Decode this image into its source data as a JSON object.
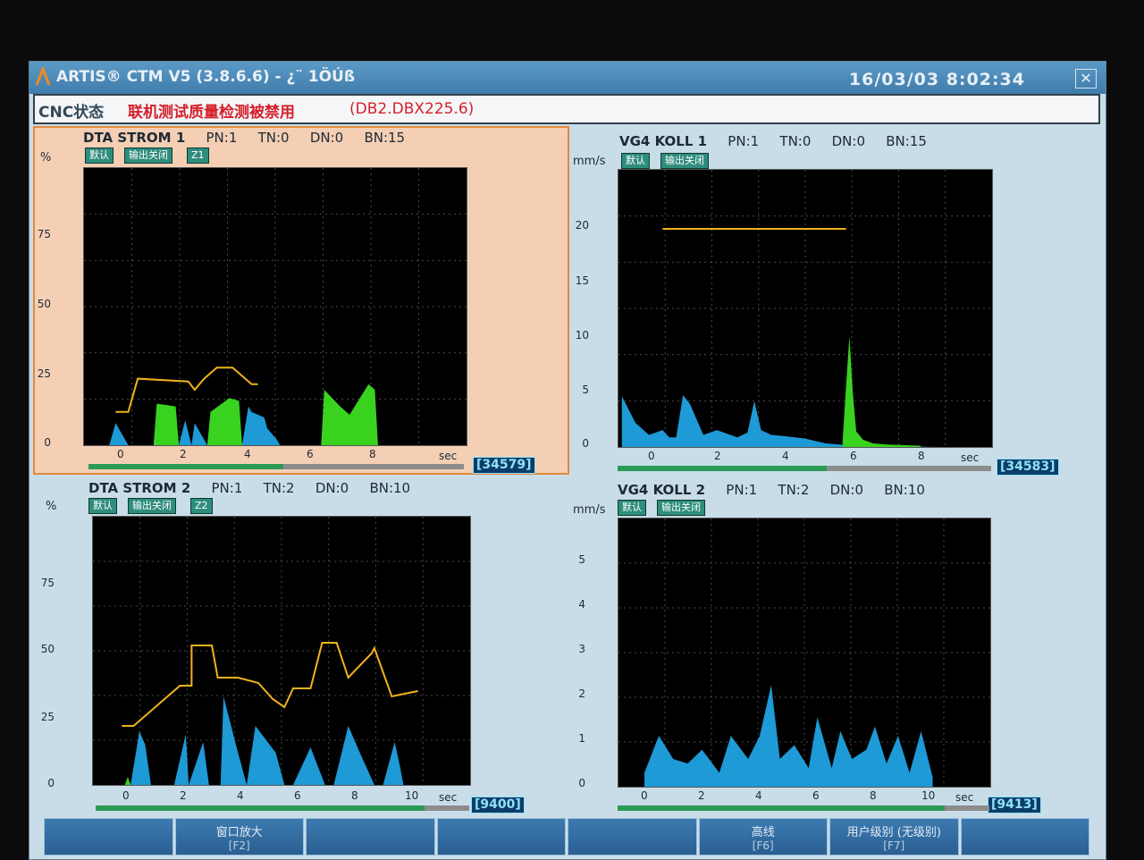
{
  "window": {
    "title": "ARTIS® CTM V5 (3.8.6.6) - ¿¨ 1ÖÚß",
    "clock": "16/03/03 8:02:34",
    "close_icon": "close-icon"
  },
  "status": {
    "label": "CNC状态",
    "message": "联机测试质量检测被禁用",
    "code": "(DB2.DBX225.6)"
  },
  "panels": [
    {
      "name": "DTA STROM 1",
      "pn": "PN:1",
      "tn": "TN:0",
      "dn": "DN:0",
      "bn": "BN:15",
      "tags": [
        "默认",
        "输出关闭",
        "Z1"
      ],
      "unit": "%",
      "yticks": [
        "75",
        "50",
        "25",
        "0"
      ],
      "xticks": [
        "0",
        "2",
        "4",
        "6",
        "8"
      ],
      "xunit": "sec",
      "sample_count": "[34579]",
      "progress": 0.52
    },
    {
      "name": "VG4 KOLL 1",
      "pn": "PN:1",
      "tn": "TN:0",
      "dn": "DN:0",
      "bn": "BN:15",
      "tags": [
        "默认",
        "输出关闭"
      ],
      "unit": "mm/s",
      "yticks": [
        "20",
        "15",
        "10",
        "5",
        "0"
      ],
      "xticks": [
        "0",
        "2",
        "4",
        "6",
        "8"
      ],
      "xunit": "sec",
      "sample_count": "[34583]",
      "progress": 0.56
    },
    {
      "name": "DTA STROM 2",
      "pn": "PN:1",
      "tn": "TN:2",
      "dn": "DN:0",
      "bn": "BN:10",
      "tags": [
        "默认",
        "输出关闭",
        "Z2"
      ],
      "unit": "%",
      "yticks": [
        "75",
        "50",
        "25",
        "0"
      ],
      "xticks": [
        "0",
        "2",
        "4",
        "6",
        "8",
        "10"
      ],
      "xunit": "sec",
      "sample_count": "[9400]",
      "progress": 0.88
    },
    {
      "name": "VG4 KOLL 2",
      "pn": "PN:1",
      "tn": "TN:2",
      "dn": "DN:0",
      "bn": "BN:10",
      "tags": [
        "默认",
        "输出关闭"
      ],
      "unit": "mm/s",
      "yticks": [
        "5",
        "4",
        "3",
        "2",
        "1",
        "0"
      ],
      "xticks": [
        "0",
        "2",
        "4",
        "6",
        "8",
        "10"
      ],
      "xunit": "sec",
      "sample_count": "[9413]",
      "progress": 0.88
    }
  ],
  "fkeys": [
    {
      "label": "",
      "key": ""
    },
    {
      "label": "窗口放大",
      "key": "[F2]"
    },
    {
      "label": "",
      "key": ""
    },
    {
      "label": "",
      "key": ""
    },
    {
      "label": "",
      "key": ""
    },
    {
      "label": "高线",
      "key": "[F6]"
    },
    {
      "label": "用户级别 (无级别)",
      "key": "[F7]"
    },
    {
      "label": "",
      "key": ""
    }
  ],
  "colors": {
    "fill_blue": "#1e9ad6",
    "fill_green": "#39d21f",
    "fill_red": "#e02020",
    "limit_yellow": "#f0b21a",
    "grid": "#4a4a4a"
  },
  "chart_data": [
    {
      "type": "area",
      "ylabel": "%",
      "xlabel": "sec",
      "ylim": [
        0,
        100
      ],
      "xlim": [
        -0.8,
        11.3
      ],
      "series": [
        {
          "color": "blue",
          "x": [
            0.0,
            0.2,
            0.4,
            0.6,
            1.4,
            1.5,
            1.7,
            2.1,
            2.2,
            2.4,
            2.6,
            2.7,
            3.1,
            3.2,
            3.6,
            3.7,
            4.1,
            4.2,
            4.4,
            4.5,
            4.9,
            5.0,
            5.3,
            5.4
          ],
          "y": [
            0,
            8,
            4,
            0,
            0,
            12,
            11,
            13,
            0,
            9,
            0,
            8,
            0,
            9,
            12,
            8,
            16,
            0,
            14,
            12,
            10,
            6,
            2,
            0
          ]
        },
        {
          "color": "green",
          "x": [
            1.4,
            1.5,
            2.1,
            2.2,
            3.1,
            3.2,
            3.8,
            4.1,
            4.2,
            6.7,
            6.8,
            7.3,
            7.6,
            8.2,
            8.4,
            8.5
          ],
          "y": [
            0,
            15,
            14,
            0,
            0,
            12,
            17,
            16,
            0,
            0,
            20,
            14,
            11,
            22,
            20,
            0
          ]
        }
      ],
      "limit_line": {
        "x": [
          0.2,
          0.6,
          0.9,
          2.5,
          2.7,
          3.0,
          3.4,
          3.9,
          4.5,
          4.7
        ],
        "y": [
          12,
          12,
          24,
          23,
          20,
          24,
          28,
          28,
          22,
          22
        ]
      }
    },
    {
      "type": "area",
      "ylabel": "mm/s",
      "xlabel": "sec",
      "ylim": [
        0,
        23
      ],
      "xlim": [
        -0.9,
        10.1
      ],
      "series": [
        {
          "color": "blue",
          "x": [
            -0.8,
            -0.4,
            0.0,
            0.4,
            0.6,
            0.8,
            1.0,
            1.2,
            1.6,
            2.0,
            2.6,
            2.9,
            3.1,
            3.3,
            3.6,
            4.0,
            4.6,
            5.2,
            5.6,
            6.5,
            8.5
          ],
          "y": [
            4.2,
            2.0,
            1.0,
            1.4,
            0.8,
            0.8,
            4.3,
            3.6,
            1.0,
            1.4,
            0.8,
            1.2,
            3.8,
            1.4,
            1.0,
            0.9,
            0.7,
            0.3,
            0.2,
            0.1,
            0.0
          ]
        },
        {
          "color": "green",
          "x": [
            5.7,
            5.8,
            5.9,
            6.0,
            6.1,
            6.3,
            6.6,
            7.0,
            8.0
          ],
          "y": [
            0.5,
            5.0,
            9.2,
            4.5,
            1.3,
            0.6,
            0.3,
            0.2,
            0.1
          ]
        }
      ],
      "limit_line": {
        "x": [
          0.4,
          5.8
        ],
        "y": [
          18.1,
          18.1
        ]
      }
    },
    {
      "type": "area",
      "ylabel": "%",
      "xlabel": "sec",
      "ylim": [
        0,
        100
      ],
      "xlim": [
        -1.0,
        12.0
      ],
      "series": [
        {
          "color": "blue",
          "x": [
            0.3,
            0.6,
            0.8,
            1.0,
            1.8,
            2.2,
            2.3,
            2.8,
            3.0,
            3.4,
            3.5,
            4.0,
            4.3,
            4.6,
            5.3,
            5.6,
            5.9,
            6.5,
            7.0,
            7.3,
            7.8,
            8.2,
            8.7,
            9.0,
            9.4,
            9.6,
            9.7,
            10.4
          ],
          "y": [
            0,
            20,
            15,
            0,
            0,
            19,
            0,
            16,
            0,
            0,
            33,
            12,
            0,
            22,
            12,
            0,
            0,
            14,
            0,
            0,
            22,
            12,
            0,
            0,
            16,
            6,
            0,
            0
          ]
        },
        {
          "color": "green",
          "x": [
            0.1,
            0.2,
            0.3
          ],
          "y": [
            0,
            3,
            0
          ]
        }
      ],
      "limit_line": {
        "x": [
          0.0,
          0.4,
          2.0,
          2.4,
          2.4,
          3.1,
          3.3,
          4.0,
          4.7,
          5.2,
          5.6,
          5.9,
          6.5,
          6.9,
          7.4,
          7.8,
          8.6,
          8.7,
          9.3,
          10.2
        ],
        "y": [
          22,
          22,
          37,
          37,
          52,
          52,
          40,
          40,
          38,
          32,
          29,
          36,
          36,
          53,
          53,
          40,
          49,
          51,
          33,
          35
        ]
      }
    },
    {
      "type": "area",
      "ylabel": "mm/s",
      "xlabel": "sec",
      "ylim": [
        0,
        5.8
      ],
      "xlim": [
        -0.9,
        12.0
      ],
      "series": [
        {
          "color": "blue",
          "x": [
            0.0,
            0.5,
            1.0,
            1.5,
            2.0,
            2.6,
            3.0,
            3.6,
            4.0,
            4.4,
            4.7,
            5.2,
            5.7,
            6.0,
            6.5,
            6.8,
            7.2,
            7.7,
            8.0,
            8.4,
            8.8,
            9.2,
            9.6,
            10.0
          ],
          "y": [
            0.3,
            1.1,
            0.6,
            0.5,
            0.8,
            0.3,
            1.1,
            0.6,
            1.1,
            2.2,
            0.6,
            0.9,
            0.4,
            1.5,
            0.4,
            1.2,
            0.6,
            0.8,
            1.3,
            0.5,
            1.1,
            0.3,
            1.2,
            0.2
          ]
        }
      ],
      "limit_line": {
        "x": [],
        "y": []
      }
    }
  ]
}
